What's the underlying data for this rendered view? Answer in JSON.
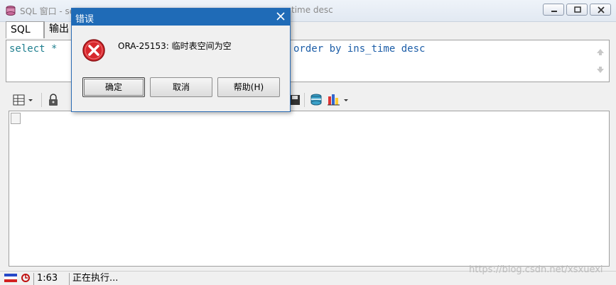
{
  "window": {
    "title_start": "SQL 窗口 - se",
    "title_end": "time desc",
    "controls": [
      "minimize",
      "maximize",
      "close"
    ]
  },
  "tabs": [
    {
      "label": "SQL",
      "active": true
    },
    {
      "label": "输出",
      "active": false
    }
  ],
  "editor": {
    "visible_left": "select *",
    "visible_right": "order by ins_time desc"
  },
  "toolbar": {
    "icons": [
      "grid-layout-icon",
      "lock-icon",
      "save-icon",
      "database-query-icon",
      "chart-icon"
    ]
  },
  "status": {
    "position": "1:63",
    "message": "正在执行..."
  },
  "watermark": "https://blog.csdn.net/xsxuexi",
  "dialog": {
    "title": "错误",
    "message": "ORA-25153: 临时表空间为空",
    "buttons": {
      "ok": "确定",
      "cancel": "取消",
      "help": "帮助(H)"
    }
  },
  "colors": {
    "dialog_title_bg": "#1f6bb7",
    "error_red": "#d8282d",
    "keyword": "#1f7f8f"
  }
}
